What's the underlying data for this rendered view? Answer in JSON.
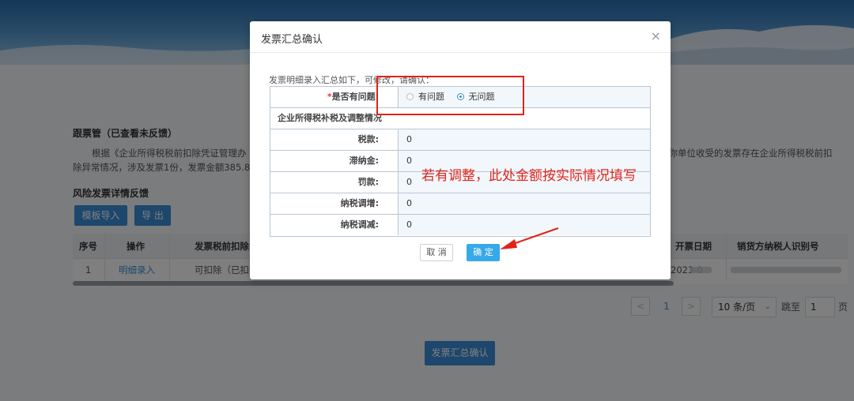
{
  "background": {
    "section_title": "跟票管（已查看未反馈）",
    "paragraph_line1_start": "根据《企业所得税税前扣除凭证管理办",
    "paragraph_line1_end": "期你单位收受的发票存在企业所得税税前扣",
    "paragraph_line2": "除异常情况，涉及发票1份，发票金额385.85",
    "risk_title": "风险发票详情反馈",
    "buttons": {
      "import": "模板导入",
      "export": "导 出"
    },
    "table": {
      "headers": [
        "序号",
        "操作",
        "发票税前扣除",
        "开票日期",
        "销货方纳税人识别号"
      ],
      "row": {
        "index": "1",
        "action": "明细录入",
        "deduction": "可扣除（已扣",
        "date": "2023-0"
      }
    },
    "pagination": {
      "prev": "<",
      "current": "1",
      "next": ">",
      "page_size": "10 条/页",
      "goto_label": "跳至",
      "goto_value": "1",
      "page_suffix": "页"
    },
    "summary_button": "发票汇总确认"
  },
  "modal": {
    "title": "发票汇总确认",
    "close": "×",
    "intro": "发票明细录入汇总如下，可修改，请确认：",
    "question": {
      "required_mark": "*",
      "label": "是否有问题:",
      "options": [
        "有问题",
        "无问题"
      ],
      "selected": "无问题"
    },
    "section_title": "企业所得税补税及调整情况",
    "rows": [
      {
        "label": "税款:",
        "value": "0"
      },
      {
        "label": "滞纳金:",
        "value": "0"
      },
      {
        "label": "罚款:",
        "value": "0"
      },
      {
        "label": "纳税调增:",
        "value": "0"
      },
      {
        "label": "纳税调减:",
        "value": "0"
      }
    ],
    "buttons": {
      "cancel": "取 消",
      "ok": "确 定"
    }
  },
  "annotation": {
    "text": "若有调整，此处金额按实际情况填写",
    "color": "#e2231a"
  },
  "colors": {
    "primary": "#3b8fd8",
    "ok_button": "#36a9e8",
    "annotation": "#e2231a"
  }
}
